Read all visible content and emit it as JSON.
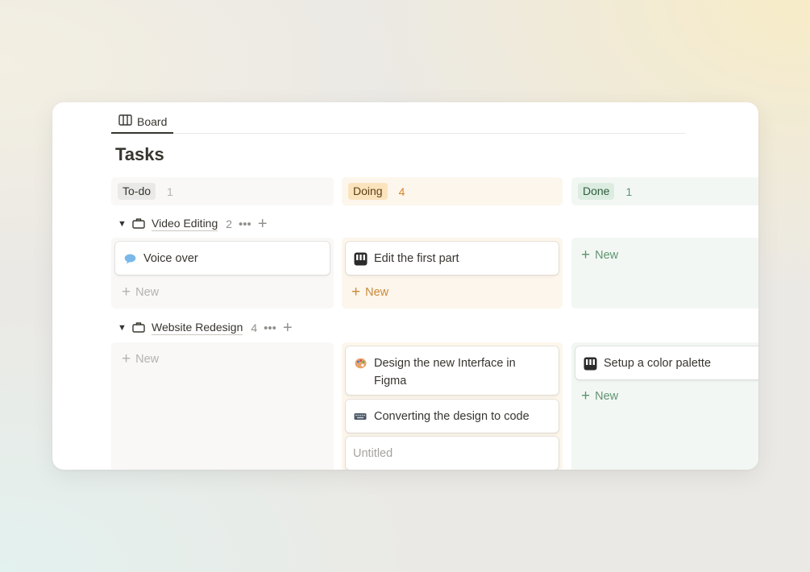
{
  "view_tab": {
    "label": "Board",
    "icon": "board-icon"
  },
  "page_title": "Tasks",
  "columns": [
    {
      "status": "To-do",
      "count": "1",
      "pill_bg": "#e9e9e7",
      "pill_color": "#37352f",
      "count_color": "#b3b2ae",
      "lane_bg": "#f9f8f7"
    },
    {
      "status": "Doing",
      "count": "4",
      "pill_bg": "#fbe4bd",
      "pill_color": "#5e3f14",
      "count_color": "#d9822b",
      "lane_bg": "#fcf6ec"
    },
    {
      "status": "Done",
      "count": "1",
      "pill_bg": "#dcece1",
      "pill_color": "#2f5d3c",
      "count_color": "#5f9470",
      "lane_bg": "#f3f7f4"
    }
  ],
  "groups": [
    {
      "title": "Video Editing",
      "count": "2",
      "cards": {
        "todo": [
          {
            "title": "Voice over",
            "icon": "speech-bubble-icon"
          }
        ],
        "doing": [
          {
            "title": "Edit the first part",
            "icon": "film-editor-icon"
          }
        ],
        "done": []
      }
    },
    {
      "title": "Website Redesign",
      "count": "4",
      "cards": {
        "todo": [],
        "doing": [
          {
            "title": "Design the new Interface in Figma",
            "icon": "artist-palette-icon"
          },
          {
            "title": "Converting the design to code",
            "icon": "keyboard-icon"
          },
          {
            "title": "Untitled",
            "icon": ""
          }
        ],
        "done": [
          {
            "title": "Setup a color palette",
            "icon": "film-editor-icon"
          }
        ]
      }
    }
  ],
  "new_label": "New",
  "colors": {
    "text": "#37352f",
    "muted": "#91908b",
    "todo_new": "#b3b2ae",
    "doing_new": "#cc8a38",
    "done_new": "#5f9470"
  }
}
